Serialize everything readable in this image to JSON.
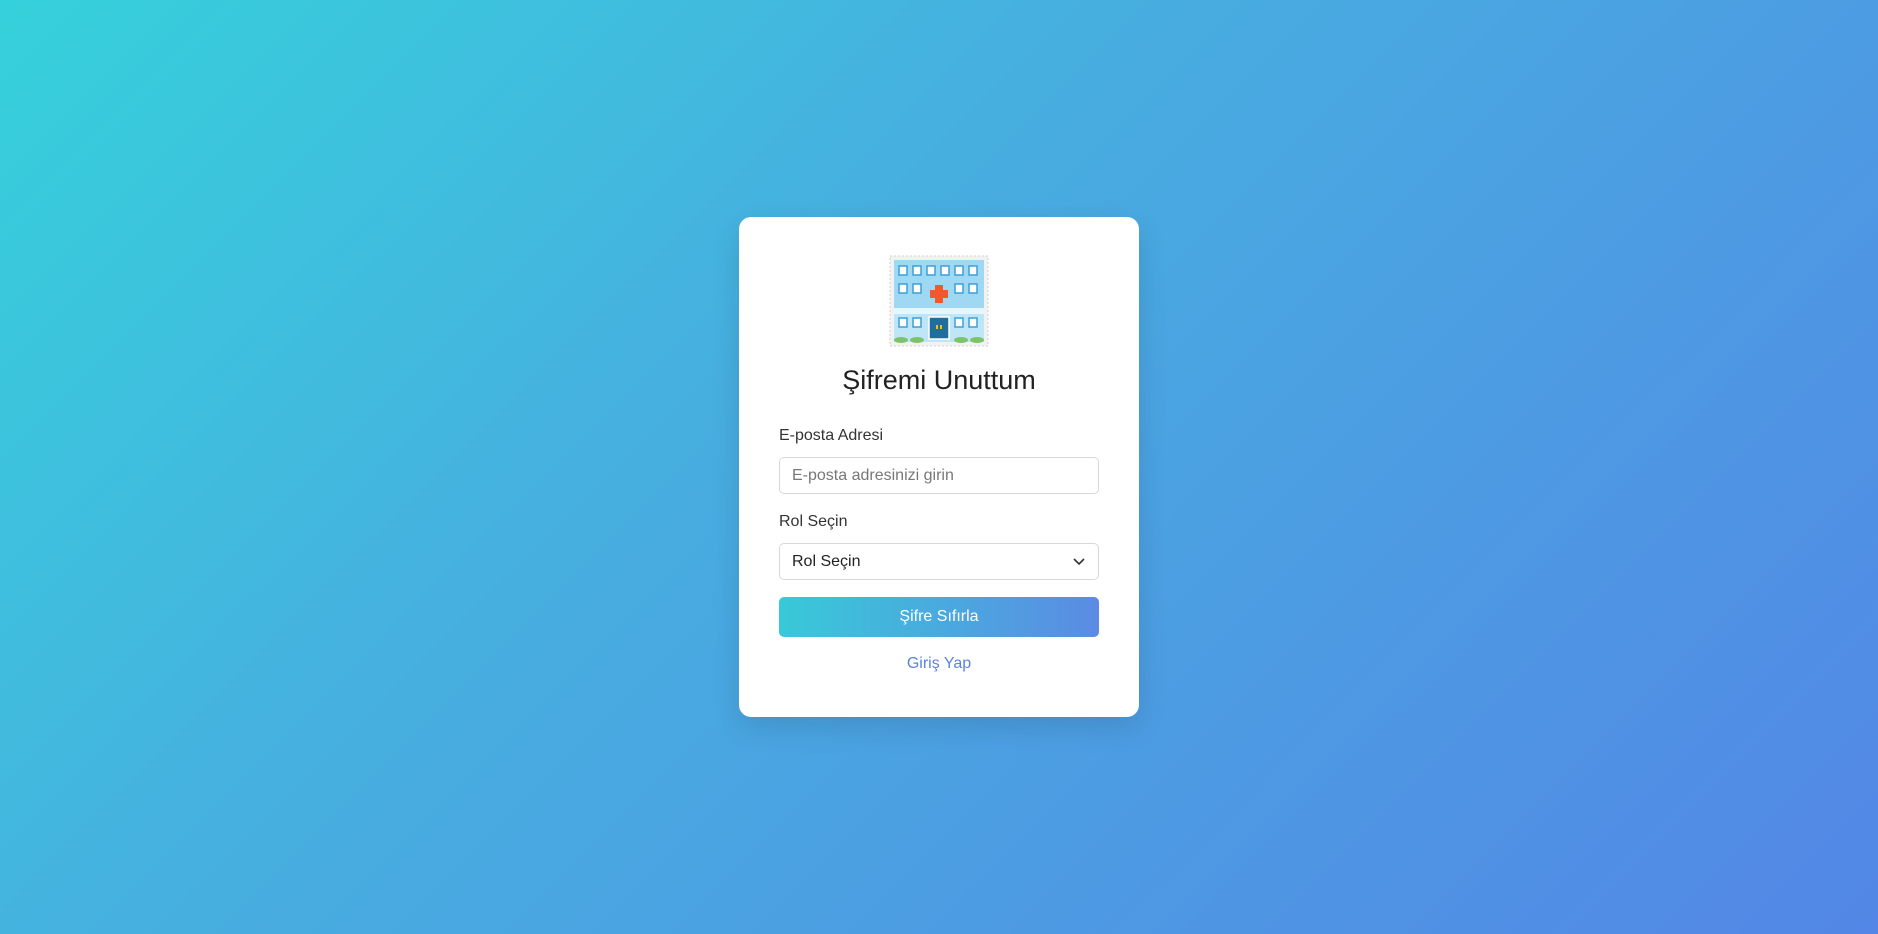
{
  "logo_icon": "hospital-icon",
  "title": "Şifremi Unuttum",
  "email": {
    "label": "E-posta Adresi",
    "placeholder": "E-posta adresinizi girin",
    "value": ""
  },
  "role": {
    "label": "Rol Seçin",
    "selected": "Rol Seçin"
  },
  "submit_label": "Şifre Sıfırla",
  "login_link": "Giriş Yap",
  "colors": {
    "bg_start": "#35d1db",
    "bg_end": "#5386e6",
    "button_start": "#38c9d8",
    "button_end": "#5b8be4",
    "link": "#5a84e2"
  }
}
